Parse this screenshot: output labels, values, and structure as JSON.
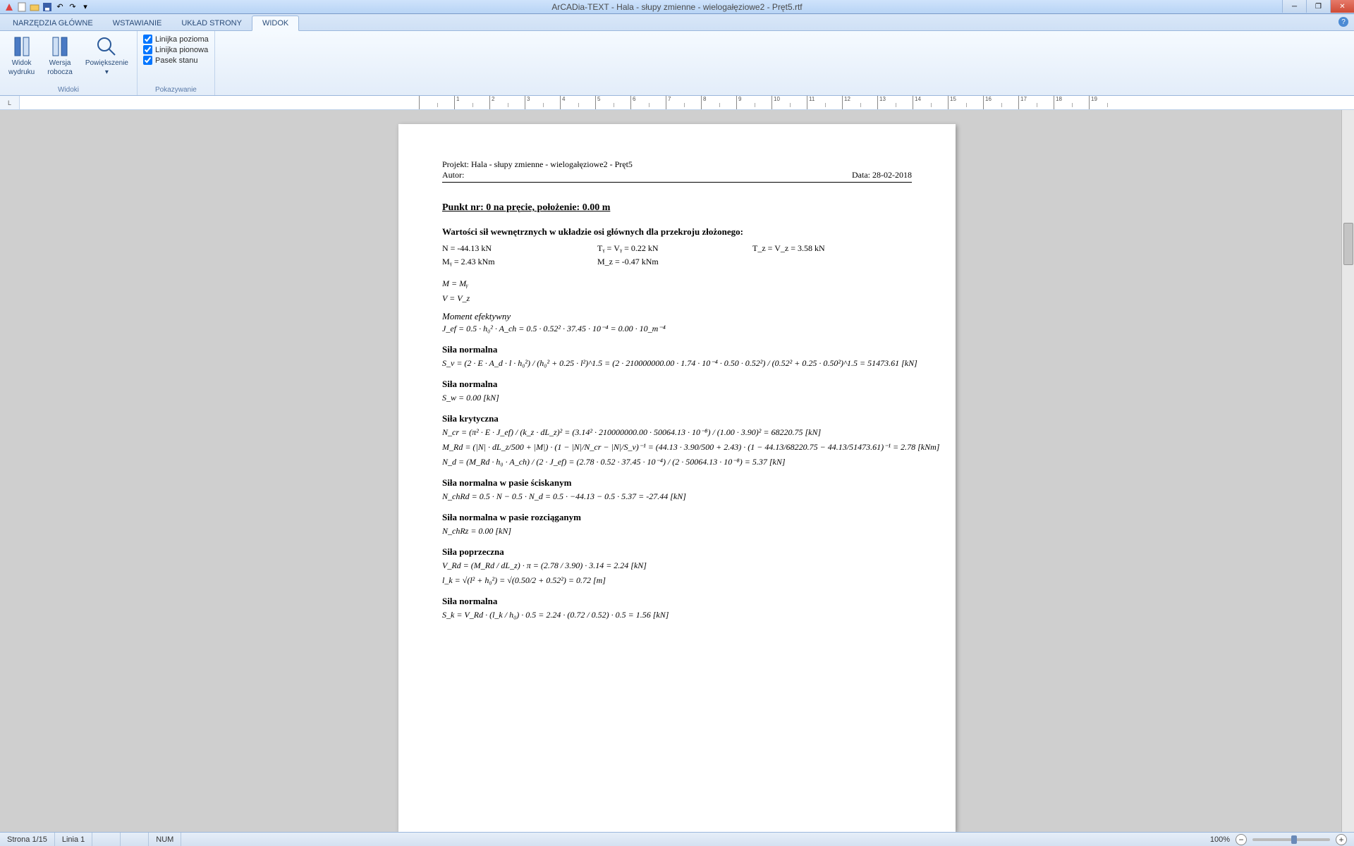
{
  "window": {
    "title": "ArCADia-TEXT - Hala - słupy zmienne - wielogałęziowe2 - Pręt5.rtf",
    "min": "─",
    "max": "❐",
    "close": "✕"
  },
  "tabs": {
    "t1": "NARZĘDZIA GŁÓWNE",
    "t2": "WSTAWIANIE",
    "t3": "UKŁAD STRONY",
    "t4": "WIDOK"
  },
  "ribbon": {
    "group1": {
      "label": "Widoki",
      "b1_l1": "Widok",
      "b1_l2": "wydruku",
      "b2_l1": "Wersja",
      "b2_l2": "robocza",
      "b3": "Powiększenie"
    },
    "group2": {
      "label": "Pokazywanie",
      "c1": "Linijka pozioma",
      "c2": "Linijka pionowa",
      "c3": "Pasek stanu"
    }
  },
  "doc": {
    "projekt_label": "Projekt:",
    "projekt_val": "Hala - słupy zmienne - wielogałęziowe2 - Pręt5",
    "autor_label": "Autor:",
    "data_label": "Data:",
    "data_val": "28-02-2018",
    "title": "Punkt nr: 0 na pręcie, położenie: 0.00 m",
    "subtitle": "Wartości sił wewnętrznych w układzie osi głównych dla przekroju złożonego:",
    "N": "N = -44.13 kN",
    "Ty": "Tᵧ = Vᵧ = 0.22 kN",
    "Tz": "T_z = V_z = 3.58 kN",
    "My": "Mᵧ = 2.43 kNm",
    "Mz": "M_z = -0.47 kNm",
    "Meq": "M = Mᵧ",
    "Veq": "V = V_z",
    "h_moment": "Moment efektywny",
    "eq_jef": "J_ef = 0.5 · h₀² · A_ch = 0.5 · 0.52² · 37.45 · 10⁻⁴ = 0.00 · 10_m⁻⁴",
    "h_normal1": "Siła normalna",
    "eq_sv": "S_v = (2 · E · A_d · l · h₀²) / (h₀² + 0.25 · l²)^1.5 = (2 · 210000000.00 · 1.74 · 10⁻⁴ · 0.50 · 0.52²) / (0.52² + 0.25 · 0.50²)^1.5 = 51473.61 [kN]",
    "h_normal2": "Siła normalna",
    "eq_sw": "S_w = 0.00 [kN]",
    "h_kryt": "Siła krytyczna",
    "eq_ncr": "N_cr = (π² · E · J_ef) / (k_z · dL_z)² = (3.14² · 210000000.00 · 50064.13 · 10⁻⁸) / (1.00 · 3.90)² = 68220.75 [kN]",
    "eq_mrd": "M_Rd = (|N| · dL_z/500 + |M|) · (1 − |N|/N_cr − |N|/S_v)⁻¹ = (44.13 · 3.90/500 + 2.43) · (1 − 44.13/68220.75 − 44.13/51473.61)⁻¹ = 2.78 [kNm]",
    "eq_nd": "N_d = (M_Rd · h₀ · A_ch) / (2 · J_ef) = (2.78 · 0.52 · 37.45 · 10⁻⁴) / (2 · 50064.13 · 10⁻⁸) = 5.37 [kN]",
    "h_paseS": "Siła normalna w pasie ściskanym",
    "eq_nchRd": "N_chRd = 0.5 · N − 0.5 · N_d = 0.5 · −44.13 − 0.5 · 5.37 = -27.44 [kN]",
    "h_paseR": "Siła normalna w pasie rozciąganym",
    "eq_nchRz": "N_chRz = 0.00 [kN]",
    "h_pop": "Siła poprzeczna",
    "eq_vrd": "V_Rd = (M_Rd / dL_z) · π = (2.78 / 3.90) · 3.14 = 2.24 [kN]",
    "eq_lk": "l_k = √(l² + h₀²) = √(0.50/2 + 0.52²) = 0.72 [m]",
    "h_normal3": "Siła normalna",
    "eq_sk": "S_k = V_Rd · (l_k / h₀) · 0.5 = 2.24 · (0.72 / 0.52) · 0.5 = 1.56 [kN]"
  },
  "status": {
    "page": "Strona 1/15",
    "line": "Linia 1",
    "num": "NUM",
    "zoom": "100%"
  }
}
